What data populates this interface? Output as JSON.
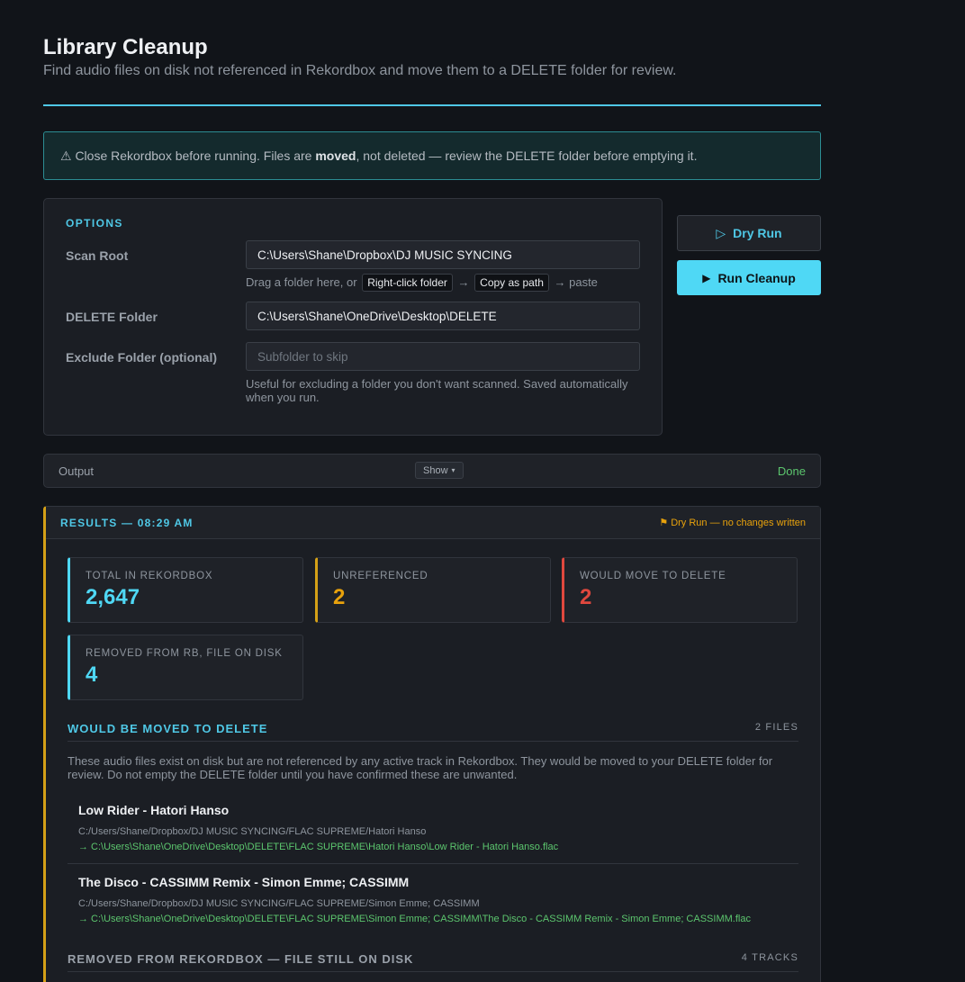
{
  "header": {
    "title": "Library Cleanup",
    "subtitle": "Find audio files on disk not referenced in Rekordbox and move them to a DELETE folder for review."
  },
  "warning": {
    "icon": "warning-icon",
    "part1": "⚠ Close Rekordbox before running. Files are ",
    "bold": "moved",
    "part2": ", not deleted — review the DELETE folder before emptying it."
  },
  "options": {
    "heading": "OPTIONS",
    "scan_root_label": "Scan Root",
    "scan_root_value": "C:\\Users\\Shane\\Dropbox\\DJ MUSIC SYNCING",
    "scan_hint_pre": "Drag a folder here, or",
    "scan_hint_key1": "Right-click folder",
    "scan_hint_arrow": "→",
    "scan_hint_key2": "Copy as path",
    "scan_hint_post": "→ paste",
    "delete_label": "DELETE Folder",
    "delete_value": "C:\\Users\\Shane\\OneDrive\\Desktop\\DELETE",
    "exclude_label": "Exclude Folder (optional)",
    "exclude_placeholder": "Subfolder to skip",
    "exclude_hint": "Useful for excluding a folder you don't want scanned. Saved automatically when you run."
  },
  "actions": {
    "dry_run_label": "Dry Run",
    "dry_run_icon": "▷",
    "run_label": "Run Cleanup",
    "run_icon": "▶"
  },
  "output": {
    "label": "Output",
    "show_label": "Show",
    "show_caret": "▾",
    "status": "Done"
  },
  "results": {
    "title": "RESULTS — 08:29 AM",
    "mode_flag": "⚑ Dry Run — no changes written",
    "stats": [
      {
        "label": "TOTAL IN REKORDBOX",
        "value": "2,647",
        "color": "#4fd8f5"
      },
      {
        "label": "UNREFERENCED",
        "value": "2",
        "color": "#e8a20c"
      },
      {
        "label": "WOULD MOVE TO DELETE",
        "value": "2",
        "color": "#e0483e"
      },
      {
        "label": "REMOVED FROM RB, FILE ON DISK",
        "value": "4",
        "color": "#4fd8f5"
      }
    ],
    "moved_section": {
      "title": "WOULD BE MOVED TO DELETE",
      "count": "2 FILES",
      "description": "These audio files exist on disk but are not referenced by any active track in Rekordbox. They would be moved to your DELETE folder for review. Do not empty the DELETE folder until you have confirmed these are unwanted.",
      "files": [
        {
          "name": "Low Rider - Hatori Hanso",
          "source": "C:/Users/Shane/Dropbox/DJ MUSIC SYNCING/FLAC SUPREME/Hatori Hanso",
          "destination": "→ C:\\Users\\Shane\\OneDrive\\Desktop\\DELETE\\FLAC SUPREME\\Hatori Hanso\\Low Rider - Hatori Hanso.flac"
        },
        {
          "name": "The Disco - CASSIMM Remix - Simon Emme; CASSIMM",
          "source": "C:/Users/Shane/Dropbox/DJ MUSIC SYNCING/FLAC SUPREME/Simon Emme; CASSIMM",
          "destination": "→ C:\\Users\\Shane\\OneDrive\\Desktop\\DELETE\\FLAC SUPREME\\Simon Emme; CASSIMM\\The Disco - CASSIMM Remix - Simon Emme; CASSIMM.flac"
        }
      ]
    },
    "removed_section": {
      "title": "REMOVED FROM REKORDBOX — FILE STILL ON DISK",
      "count": "4 TRACKS"
    }
  }
}
